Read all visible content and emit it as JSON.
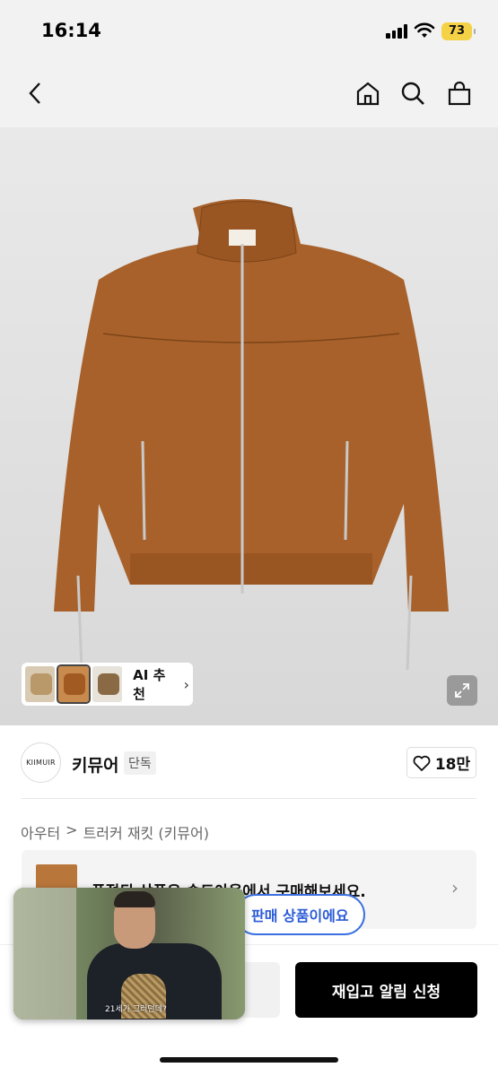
{
  "status": {
    "time": "16:14",
    "battery": "73"
  },
  "product": {
    "ai_recommend": "AI 추천",
    "brand_logo_text": "KIIMUIR",
    "brand_name": "키뮤어",
    "brand_badge": "단독",
    "likes": "18만",
    "breadcrumb": [
      "아우터",
      ">",
      "트러커 재킷 (키뮤어)"
    ]
  },
  "promo": {
    "text": "품절된 상품은 솔드아웃에서 구매해보세요.",
    "sold_chip": "판매 상품이에요"
  },
  "actions": {
    "restock_label": "재입고 알림 신청"
  },
  "video": {
    "caption": "21세가 그러던데?"
  },
  "colors": {
    "jacket": "#a8612a",
    "primary_button": "#000000",
    "chip_blue": "#2a5bd7"
  }
}
